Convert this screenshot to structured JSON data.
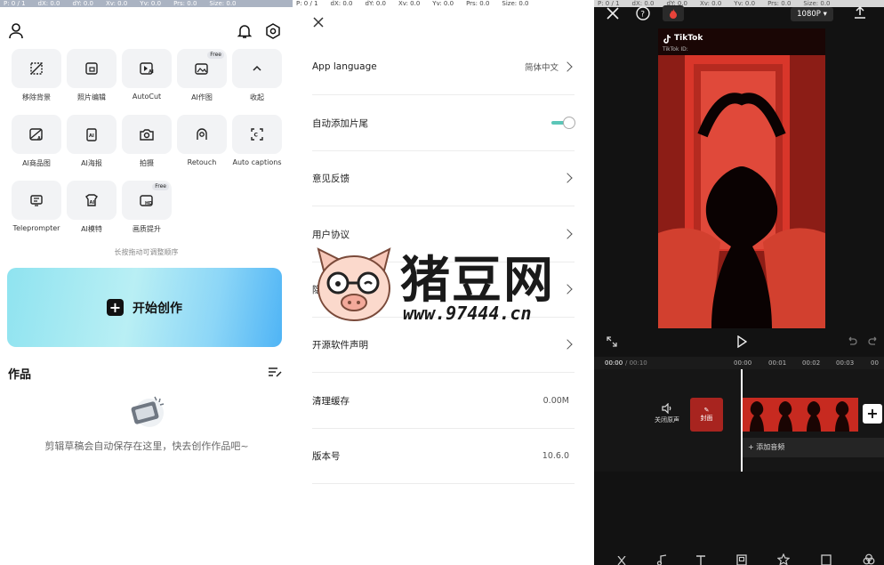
{
  "debug_bar": {
    "p": "P: 0 / 1",
    "dx": "dX: 0.0",
    "dy": "dY: 0.0",
    "xv": "Xv: 0.0",
    "yv": "Yv: 0.0",
    "prs": "Prs: 0.0",
    "size": "Size: 0.0"
  },
  "home": {
    "tools": [
      {
        "label": "移除背景",
        "icon": "remove-bg-icon"
      },
      {
        "label": "照片编辑",
        "icon": "photo-edit-icon"
      },
      {
        "label": "AutoCut",
        "icon": "autocut-icon"
      },
      {
        "label": "AI作图",
        "icon": "ai-image-icon",
        "tag": "Free"
      },
      {
        "label": "收起",
        "icon": "collapse-icon"
      },
      {
        "label": "AI商品图",
        "icon": "ai-product-icon"
      },
      {
        "label": "AI海报",
        "icon": "ai-poster-icon"
      },
      {
        "label": "拍摄",
        "icon": "camera-icon"
      },
      {
        "label": "Retouch",
        "icon": "retouch-icon"
      },
      {
        "label": "Auto captions",
        "icon": "auto-captions-icon"
      },
      {
        "label": "Teleprompter",
        "icon": "teleprompter-icon"
      },
      {
        "label": "AI模特",
        "icon": "ai-model-icon"
      },
      {
        "label": "画质提升",
        "icon": "hd-icon",
        "tag": "Free"
      }
    ],
    "hint": "长按拖动可调整顺序",
    "create_label": "开始创作",
    "works_title": "作品",
    "empty_line": "剪辑草稿会自动保存在这里，快去创作作品吧~"
  },
  "settings": {
    "rows": [
      {
        "key": "App language",
        "value": "简体中文",
        "type": "link"
      },
      {
        "key": "自动添加片尾",
        "value": "",
        "type": "toggle",
        "on": true
      },
      {
        "key": "意见反馈",
        "value": "",
        "type": "link"
      },
      {
        "key": "用户协议",
        "value": "",
        "type": "link"
      },
      {
        "key": "隐私政策",
        "value": "",
        "type": "link"
      },
      {
        "key": "开源软件声明",
        "value": "",
        "type": "link"
      },
      {
        "key": "清理缓存",
        "value": "0.00M",
        "type": "value"
      },
      {
        "key": "版本号",
        "value": "10.6.0",
        "type": "value"
      }
    ]
  },
  "watermark": {
    "title": "猪豆网",
    "url": "www.97444.cn"
  },
  "editor": {
    "resolution": "1080P",
    "brand": "TikTok",
    "brand_id": "TikTok ID:",
    "time_current": "00:00",
    "time_total": "/ 00:10",
    "ticks": [
      "00:00",
      "00:01",
      "00:02",
      "00:03",
      "00"
    ],
    "mute_label": "关闭原声",
    "cover_label": "封面",
    "add_audio": "添加音频",
    "colors": {
      "accent": "#c72a20",
      "bg": "#121212"
    }
  }
}
